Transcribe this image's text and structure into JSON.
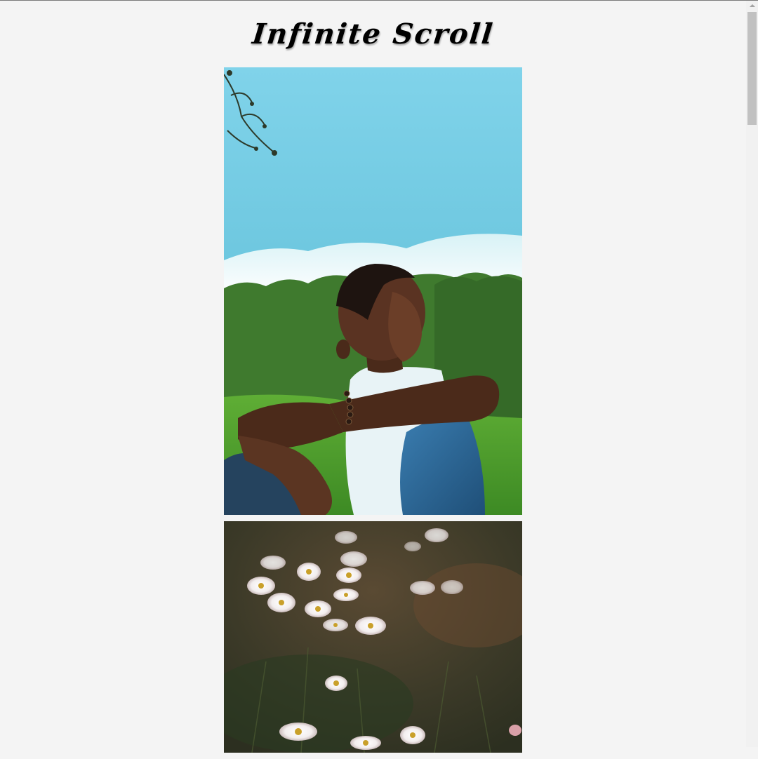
{
  "page": {
    "title": "Infinite Scroll"
  },
  "feed": {
    "photos": [
      {
        "subject": "man-sitting-on-grass-photo",
        "dominant_colors": [
          "#7fd0e6",
          "#3f7a2e",
          "#f2f4f4",
          "#2e5f8a"
        ]
      },
      {
        "subject": "white-daisies-field-photo",
        "dominant_colors": [
          "#3c3a28",
          "#5a4a33",
          "#f3eeee"
        ]
      }
    ]
  },
  "scrollbar": {
    "icon": "scroll-up-arrow-icon"
  },
  "colors": {
    "background": "#f4f4f4",
    "title": "#000000",
    "scroll_thumb": "#c1c1c1"
  }
}
